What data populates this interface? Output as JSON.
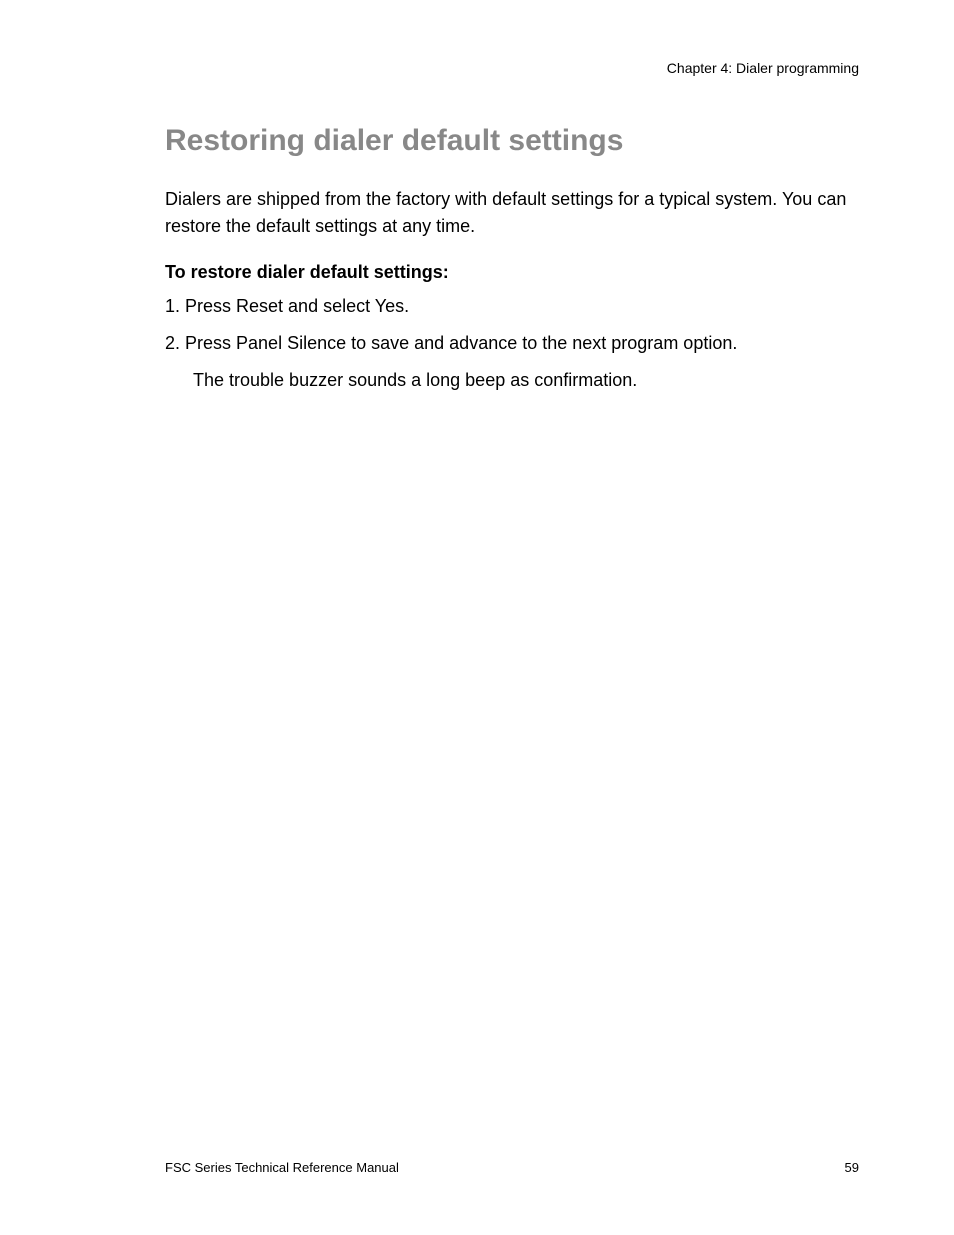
{
  "header": {
    "chapter": "Chapter 4: Dialer programming"
  },
  "main": {
    "title": "Restoring dialer default settings",
    "intro": "Dialers are shipped from the factory with default settings for a typical system. You can restore the default settings at any time.",
    "subheading": "To restore dialer default settings:",
    "steps": [
      "1.  Press Reset and select Yes.",
      "2.  Press Panel Silence to save and advance to the next program option."
    ],
    "step_continuation": "The trouble buzzer sounds a long beep as confirmation."
  },
  "footer": {
    "manual": "FSC Series Technical Reference Manual",
    "page_number": "59"
  }
}
